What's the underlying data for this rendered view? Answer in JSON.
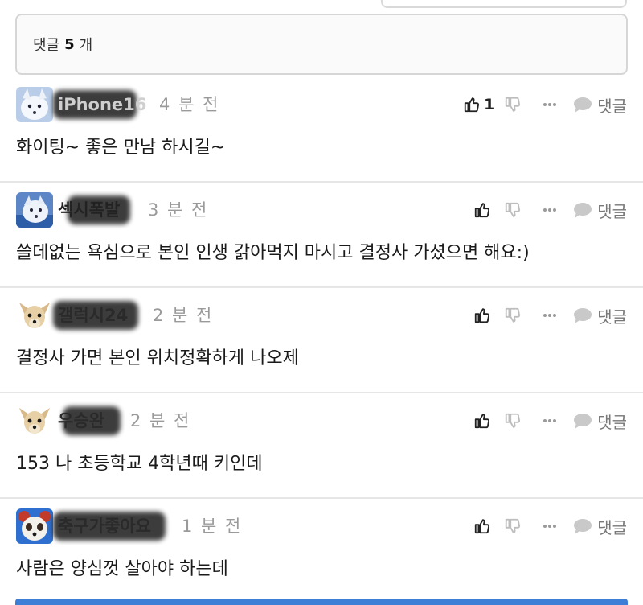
{
  "comment_count": {
    "label": "댓글",
    "count": "5",
    "unit": "개"
  },
  "comments": [
    {
      "nickname": "iPhone16",
      "time": "4 분 전",
      "text": "화이팅~ 좋은 만남 하시길~",
      "likes": "1",
      "reply_label": "댓글",
      "avatar": "white-fox-icon"
    },
    {
      "nickname": "섹시폭발",
      "time": "3 분 전",
      "text": "쓸데없는 욕심으로 본인 인생 갉아먹지 마시고 결정사 가셨으면 해요:)",
      "likes": "",
      "reply_label": "댓글",
      "avatar": "white-wolf-icon"
    },
    {
      "nickname": "갤럭시24",
      "time": "2 분 전",
      "text": "결정사 가면 본인 위치정확하게 나오제",
      "likes": "",
      "reply_label": "댓글",
      "avatar": "chihuahua-icon"
    },
    {
      "nickname": "우승완",
      "time": "2 분 전",
      "text": "153 나 초등학교 4학년때 키인데",
      "likes": "",
      "reply_label": "댓글",
      "avatar": "chihuahua-icon"
    },
    {
      "nickname": "축구가좋아요",
      "time": "1 분 전",
      "text": "사람은 양심껏 살아야 하는데",
      "likes": "",
      "reply_label": "댓글",
      "avatar": "panda-icon"
    }
  ],
  "colors": {
    "divider": "#e6e6e6",
    "time": "#9a9a9a",
    "accent_bar": "#3d7fd6"
  }
}
